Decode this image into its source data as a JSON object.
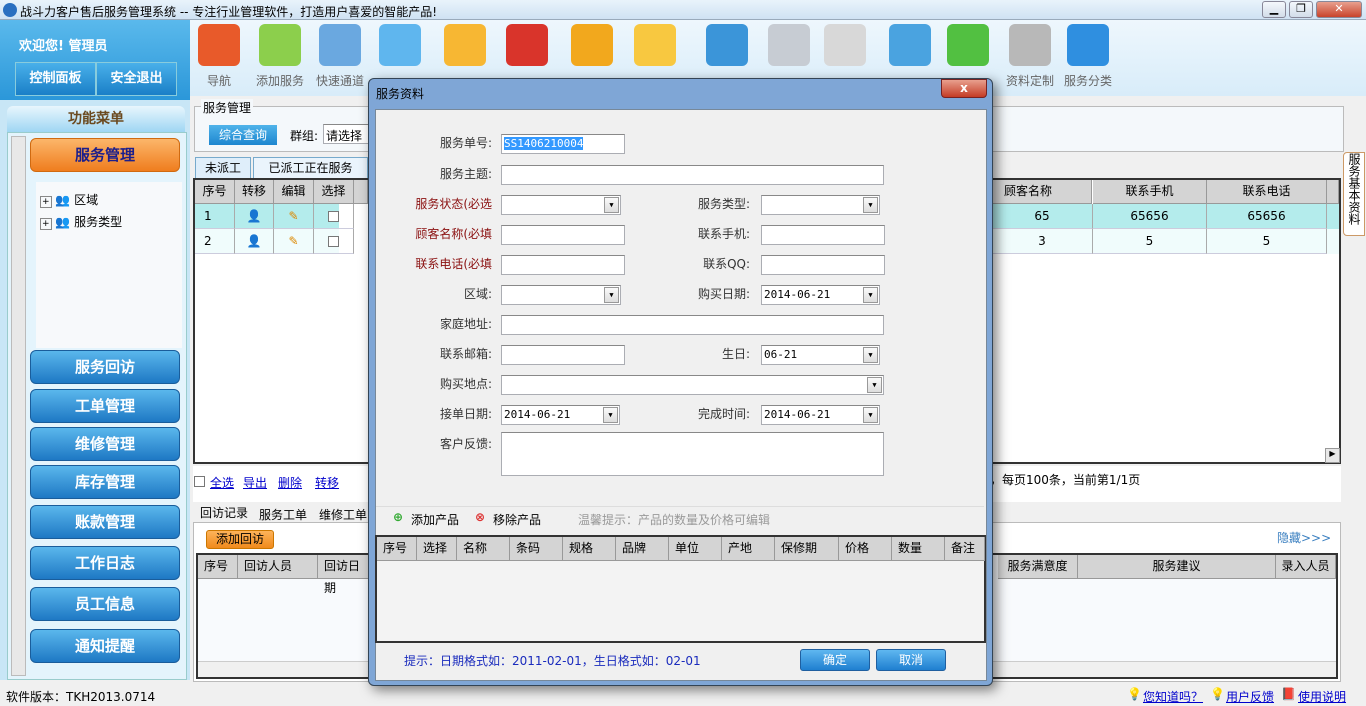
{
  "window": {
    "title": "战斗力客户售后服务管理系统 -- 专注行业管理软件，打造用户喜爱的智能产品!",
    "min": "▁",
    "max": "❐",
    "close": "✕"
  },
  "left": {
    "welcome": "欢迎您! 管理员",
    "control_panel": "控制面板",
    "logout": "安全退出",
    "menu_title": "功能菜单",
    "menu": [
      "服务管理",
      "服务回访",
      "工单管理",
      "维修管理",
      "库存管理",
      "账款管理",
      "工作日志",
      "员工信息",
      "通知提醒"
    ],
    "tree": [
      "区域",
      "服务类型"
    ]
  },
  "toolbar": [
    {
      "label": "导航",
      "icon": "home-icon",
      "color": "#e85a2a"
    },
    {
      "label": "添加服务",
      "icon": "user-add-icon",
      "color": "#8ccf4c"
    },
    {
      "label": "快速通道",
      "icon": "search-document-icon",
      "color": "#6aa8e0"
    },
    {
      "label": "",
      "icon": "flag-icon",
      "color": "#5fb6ee"
    },
    {
      "label": "",
      "icon": "notepad-icon",
      "color": "#f7b733"
    },
    {
      "label": "",
      "icon": "calendar-icon",
      "color": "#d9342b"
    },
    {
      "label": "",
      "icon": "alarm-clock-icon",
      "color": "#f2a81d"
    },
    {
      "label": "",
      "icon": "speech-bubble-icon",
      "color": "#f8c840"
    },
    {
      "label": "",
      "icon": "notebook-pen-icon",
      "color": "#3b95d9"
    },
    {
      "label": "",
      "icon": "calculator-icon",
      "color": "#c7ccd3"
    },
    {
      "label": "",
      "icon": "mail-icon",
      "color": "#d8d8d8"
    },
    {
      "label": "",
      "icon": "chart-icon",
      "color": "#4aa3e0"
    },
    {
      "label": "",
      "icon": "export-icon",
      "color": "#52c041"
    },
    {
      "label": "资料定制",
      "icon": "database-icon",
      "color": "#b8b8b8"
    },
    {
      "label": "服务分类",
      "icon": "magic-wand-icon",
      "color": "#2f8fe0"
    }
  ],
  "main": {
    "group_title": "服务管理",
    "query_btn": "综合查询",
    "group_label": "群组:",
    "group_value": "请选择",
    "tabs": [
      "未派工",
      "已派工正在服务"
    ],
    "grid_left_cols": [
      "序号",
      "转移",
      "编辑",
      "选择"
    ],
    "grid_right_cols": [
      "顾客名称",
      "联系手机",
      "联系电话"
    ],
    "rows": [
      {
        "no": "1",
        "customer": "65",
        "mobile": "65656",
        "phone": "65656"
      },
      {
        "no": "2",
        "customer": "3",
        "mobile": "5",
        "phone": "5"
      }
    ],
    "links": [
      "全选",
      "导出",
      "删除",
      "转移"
    ],
    "paging": "，每页100条，当前第1/1页",
    "side_tab": "服务基本资料",
    "bottom_tabs": [
      "回访记录",
      "服务工单",
      "维修工单"
    ],
    "add_visit": "添加回访",
    "hide": "隐藏>>>",
    "bottom_left_cols": [
      "序号",
      "回访人员",
      "回访日期"
    ],
    "bottom_right_cols": [
      "服务满意度",
      "服务建议",
      "录入人员"
    ]
  },
  "status": {
    "version": "软件版本：TKH2013.0714",
    "links": [
      "您知道吗？",
      "用户反馈",
      "使用说明"
    ]
  },
  "dialog": {
    "title": "服务资料",
    "fields": {
      "no_label": "服务单号:",
      "no_value": "SS1406210004",
      "subject": "服务主题:",
      "state": "服务状态(必选",
      "type": "服务类型:",
      "customer": "顾客名称(必填",
      "mobile": "联系手机:",
      "phone": "联系电话(必填",
      "qq": "联系QQ:",
      "area": "区域:",
      "buy_date": "购买日期:",
      "buy_date_value": "2014-06-21",
      "address": "家庭地址:",
      "email": "联系邮箱:",
      "birthday": "生日:",
      "birthday_value": "06-21",
      "buy_place": "购买地点:",
      "order_date": "接单日期:",
      "order_date_value": "2014-06-21",
      "finish": "完成时间:",
      "finish_value": "2014-06-21",
      "feedback": "客户反馈:"
    },
    "add_product": "添加产品",
    "remove_product": "移除产品",
    "tip": "温馨提示：产品的数量及价格可编辑",
    "product_cols": [
      "序号",
      "选择",
      "名称",
      "条码",
      "规格",
      "品牌",
      "单位",
      "产地",
      "保修期",
      "价格",
      "数量",
      "备注"
    ],
    "hint": "提示：日期格式如：2011-02-01，生日格式如：02-01",
    "ok": "确定",
    "cancel": "取消"
  }
}
